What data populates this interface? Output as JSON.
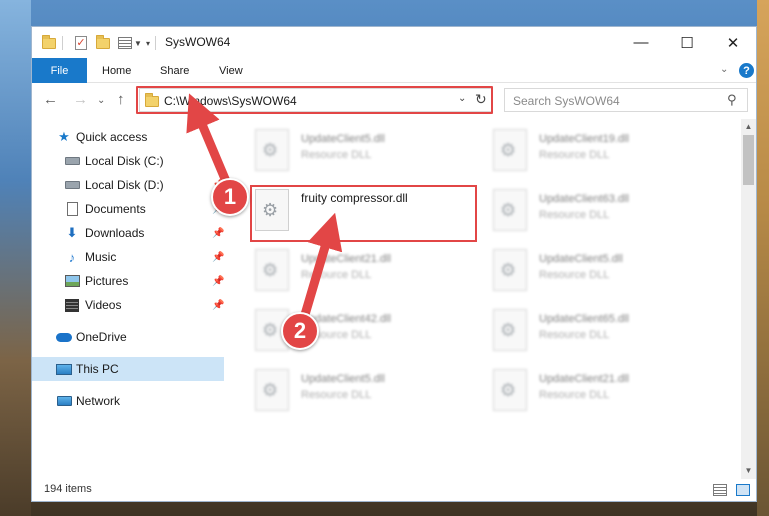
{
  "window": {
    "title": "SysWOW64",
    "minimize": "—",
    "maximize": "☐",
    "close": "✕"
  },
  "ribbon": {
    "tabs": [
      "File",
      "Home",
      "Share",
      "View"
    ],
    "expand_icon": "⌄",
    "help_icon": "?"
  },
  "nav": {
    "back": "←",
    "forward": "→",
    "recent": "⌄",
    "up": "↑",
    "address": "C:\\Windows\\SysWOW64",
    "address_dropdown": "⌄",
    "refresh": "↻",
    "search_placeholder": "Search SysWOW64",
    "search_icon": "⚲"
  },
  "sidebar": {
    "pin": "📌",
    "items": [
      {
        "label": "Quick access",
        "icon": "star-icon"
      },
      {
        "label": "Local Disk (C:)",
        "icon": "drive-icon"
      },
      {
        "label": "Local Disk (D:)",
        "icon": "drive-icon"
      },
      {
        "label": "Documents",
        "icon": "document-icon"
      },
      {
        "label": "Downloads",
        "icon": "download-icon"
      },
      {
        "label": "Music",
        "icon": "music-icon"
      },
      {
        "label": "Pictures",
        "icon": "picture-icon"
      },
      {
        "label": "Videos",
        "icon": "video-icon"
      },
      {
        "label": "OneDrive",
        "icon": "cloud-icon"
      },
      {
        "label": "This PC",
        "icon": "computer-icon"
      },
      {
        "label": "Network",
        "icon": "network-icon"
      }
    ]
  },
  "files": [
    {
      "name": "UpdateClient5.dll",
      "type": "Resource DLL"
    },
    {
      "name": "UpdateClient19.dll",
      "type": "Resource DLL"
    },
    {
      "name": "fruity compressor.dll",
      "type": ""
    },
    {
      "name": "UpdateClient63.dll",
      "type": "Resource DLL"
    },
    {
      "name": "UpdateClient21.dll",
      "type": "Resource DLL"
    },
    {
      "name": "UpdateClient5.dll",
      "type": "Resource DLL"
    },
    {
      "name": "UpdateClient42.dll",
      "type": "Resource DLL"
    },
    {
      "name": "UpdateClient65.dll",
      "type": "Resource DLL"
    },
    {
      "name": "UpdateClient5.dll",
      "type": "Resource DLL"
    },
    {
      "name": "UpdateClient21.dll",
      "type": "Resource DLL"
    }
  ],
  "status": {
    "item_count": "194 items"
  },
  "annotations": {
    "step1": "1",
    "step2": "2",
    "color": "#e24646"
  }
}
